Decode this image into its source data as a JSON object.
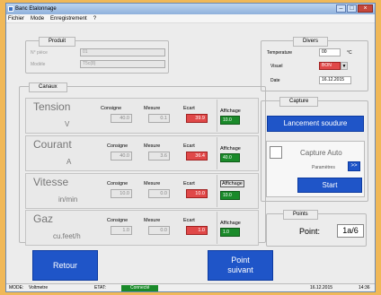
{
  "window": {
    "title": "Banc Etalonnage",
    "min": "–",
    "max": "□",
    "close": "×"
  },
  "menu": [
    "Fichier",
    "Mode",
    "Enregistrement",
    "?"
  ],
  "produit": {
    "title": "Produit",
    "fields": [
      {
        "label": "N° pièce",
        "value": "01"
      },
      {
        "label": "Modèle",
        "value": "T5c(8)"
      }
    ]
  },
  "divers": {
    "title": "Divers",
    "temperature": {
      "label": "Temperature",
      "value": "00",
      "unit": "°C"
    },
    "visuel": {
      "label": "Visuel",
      "value": "BON",
      "arrow": "▼"
    },
    "date": {
      "label": "Date",
      "value": "16.12.2015"
    }
  },
  "canaux": {
    "title": "Canaux",
    "rows": [
      {
        "name": "Tension",
        "unit": "V",
        "consigne_label": "Consigne",
        "mesure_label": "Mesure",
        "ecart_label": "Ecart",
        "affichage_label": "Affichage",
        "consigne": "40.0",
        "mesure": "0.1",
        "ecart": "39.9",
        "affichage": "10.0"
      },
      {
        "name": "Courant",
        "unit": "A",
        "consigne_label": "Consigne",
        "mesure_label": "Mesure",
        "ecart_label": "Ecart",
        "affichage_label": "Affichage",
        "consigne": "40.0",
        "mesure": "3.6",
        "ecart": "36.4",
        "affichage": "40.0"
      },
      {
        "name": "Vitesse",
        "unit": "in/min",
        "consigne_label": "Consigne",
        "mesure_label": "Mesure",
        "ecart_label": "Ecart",
        "affichage_label": "Affichage",
        "consigne": "10.0",
        "mesure": "0.0",
        "ecart": "10.0",
        "affichage": "10.0"
      },
      {
        "name": "Gaz",
        "unit": "cu.feet/h",
        "consigne_label": "Consigne",
        "mesure_label": "Mesure",
        "ecart_label": "Ecart",
        "affichage_label": "Affichage",
        "consigne": "1.0",
        "mesure": "0.0",
        "ecart": "1.0",
        "affichage": "1.0"
      }
    ]
  },
  "capture": {
    "title": "Capture",
    "lancement": "Lancement soudure",
    "auto_label": "Capture Auto",
    "params_label": "Paramètres",
    "params_btn": ">>",
    "start": "Start"
  },
  "points": {
    "title": "Points",
    "label": "Point:",
    "value": "1a/6"
  },
  "buttons": {
    "retour": "Retour",
    "point_suivant_1": "Point",
    "point_suivant_2": "suivant"
  },
  "status": {
    "mode_label": "MODE:",
    "mode_value": "Voltmetre",
    "etat_label": "ETAT:",
    "etat_value": "Connecté",
    "date": "16.12.2015",
    "time": "14:36"
  },
  "colors": {
    "red_ecart": "#e04848",
    "green_affichage": "#1a8a2a",
    "blue_button": "#1f55c8",
    "background": "#f0b858"
  }
}
